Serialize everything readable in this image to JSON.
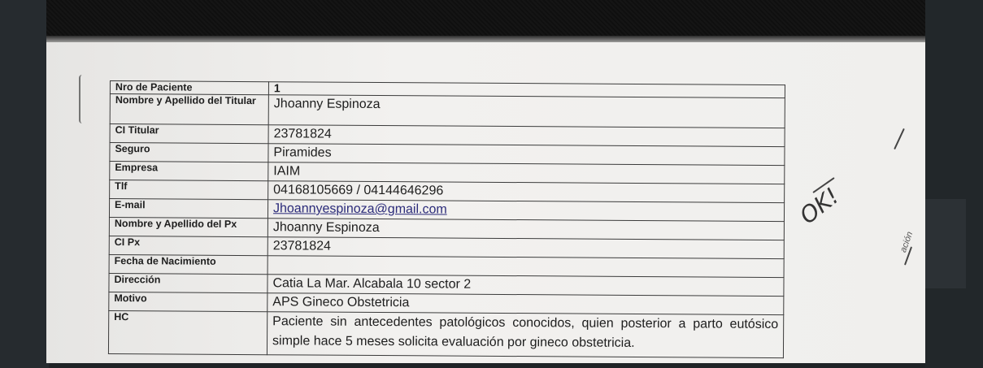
{
  "form": {
    "rows": [
      {
        "label": "Nro de Paciente",
        "value": "1"
      },
      {
        "label": "Nombre y Apellido del Titular",
        "value": "Jhoanny Espinoza"
      },
      {
        "label": "CI Titular",
        "value": "23781824"
      },
      {
        "label": "Seguro",
        "value": "Piramides"
      },
      {
        "label": "Empresa",
        "value": "IAIM"
      },
      {
        "label": "Tlf",
        "value": "04168105669 / 04144646296"
      },
      {
        "label": "E-mail",
        "value": "Jhoannyespinoza@gmail.com"
      },
      {
        "label": "Nombre y Apellido del Px",
        "value": "Jhoanny Espinoza"
      },
      {
        "label": "CI Px",
        "value": "23781824"
      },
      {
        "label": "Fecha de Nacimiento",
        "value": ""
      },
      {
        "label": "Dirección",
        "value": "Catia La Mar. Alcabala 10 sector 2"
      },
      {
        "label": "Motivo",
        "value": "APS Gineco Obstetricia"
      },
      {
        "label": "HC",
        "value": "Paciente sin antecedentes patológicos conocidos, quien posterior a parto eutósico simple hace 5 meses solicita evaluación por gineco obstetricia."
      }
    ]
  },
  "annotations": {
    "handwritten_ok": "OK!",
    "side_margin": "ación"
  }
}
